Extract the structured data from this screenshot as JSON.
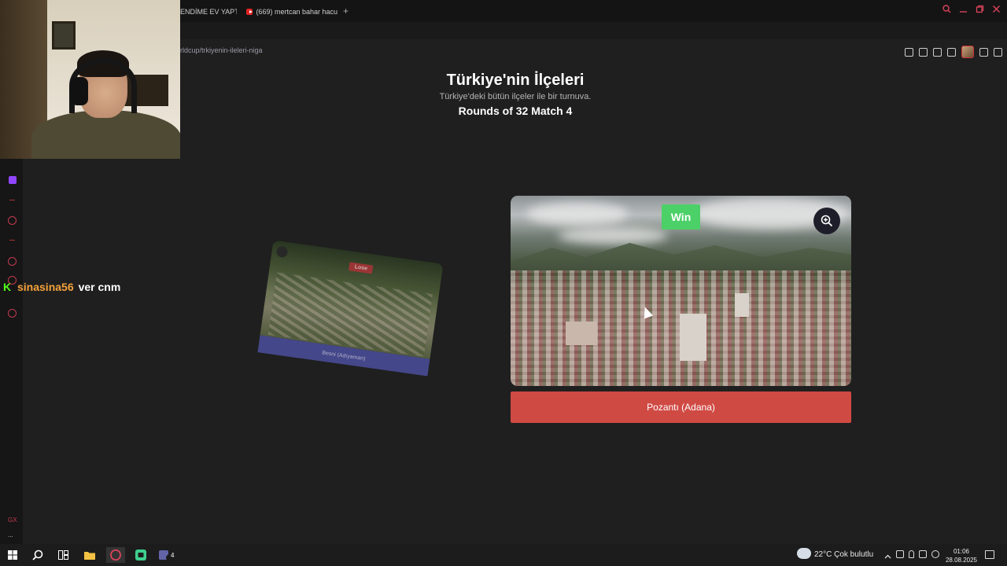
{
  "browser": {
    "tabs": [
      {
        "label": "ENDİME EV YAPTI",
        "icon": "page-icon"
      },
      {
        "label": "(669) mertcan bahar hacu",
        "icon": "youtube-icon"
      }
    ],
    "new_tab": "+",
    "url": "rldcup/trkiyenin-ileleri-niga"
  },
  "chat": {
    "badge": "K",
    "username": "sinasina56",
    "message": "ver cnm"
  },
  "page": {
    "title": "Türkiye'nin İlçeleri",
    "subtitle": "Türkiye'deki bütün ilçeler ile bir turnuva.",
    "round": "Rounds of 32 Match 4"
  },
  "match": {
    "loser": {
      "badge": "Lose",
      "label": "Besni (Adıyaman)"
    },
    "winner": {
      "badge": "Win",
      "label": "Pozantı (Adana)"
    }
  },
  "sidebar": {
    "bottom_label": "GX",
    "more": "..."
  },
  "taskbar": {
    "weather": "22°C  Çok bulutlu",
    "time": "01:06",
    "date": "28.08.2025",
    "teams_badge": "4"
  },
  "colors": {
    "win_badge": "#4cd068",
    "lose_badge": "#b03a3a",
    "winner_label_bg": "#d04a44",
    "loser_label_bg": "#4b4e9c",
    "chat_username": "#f4a23b",
    "kick_green": "#53fc18"
  }
}
